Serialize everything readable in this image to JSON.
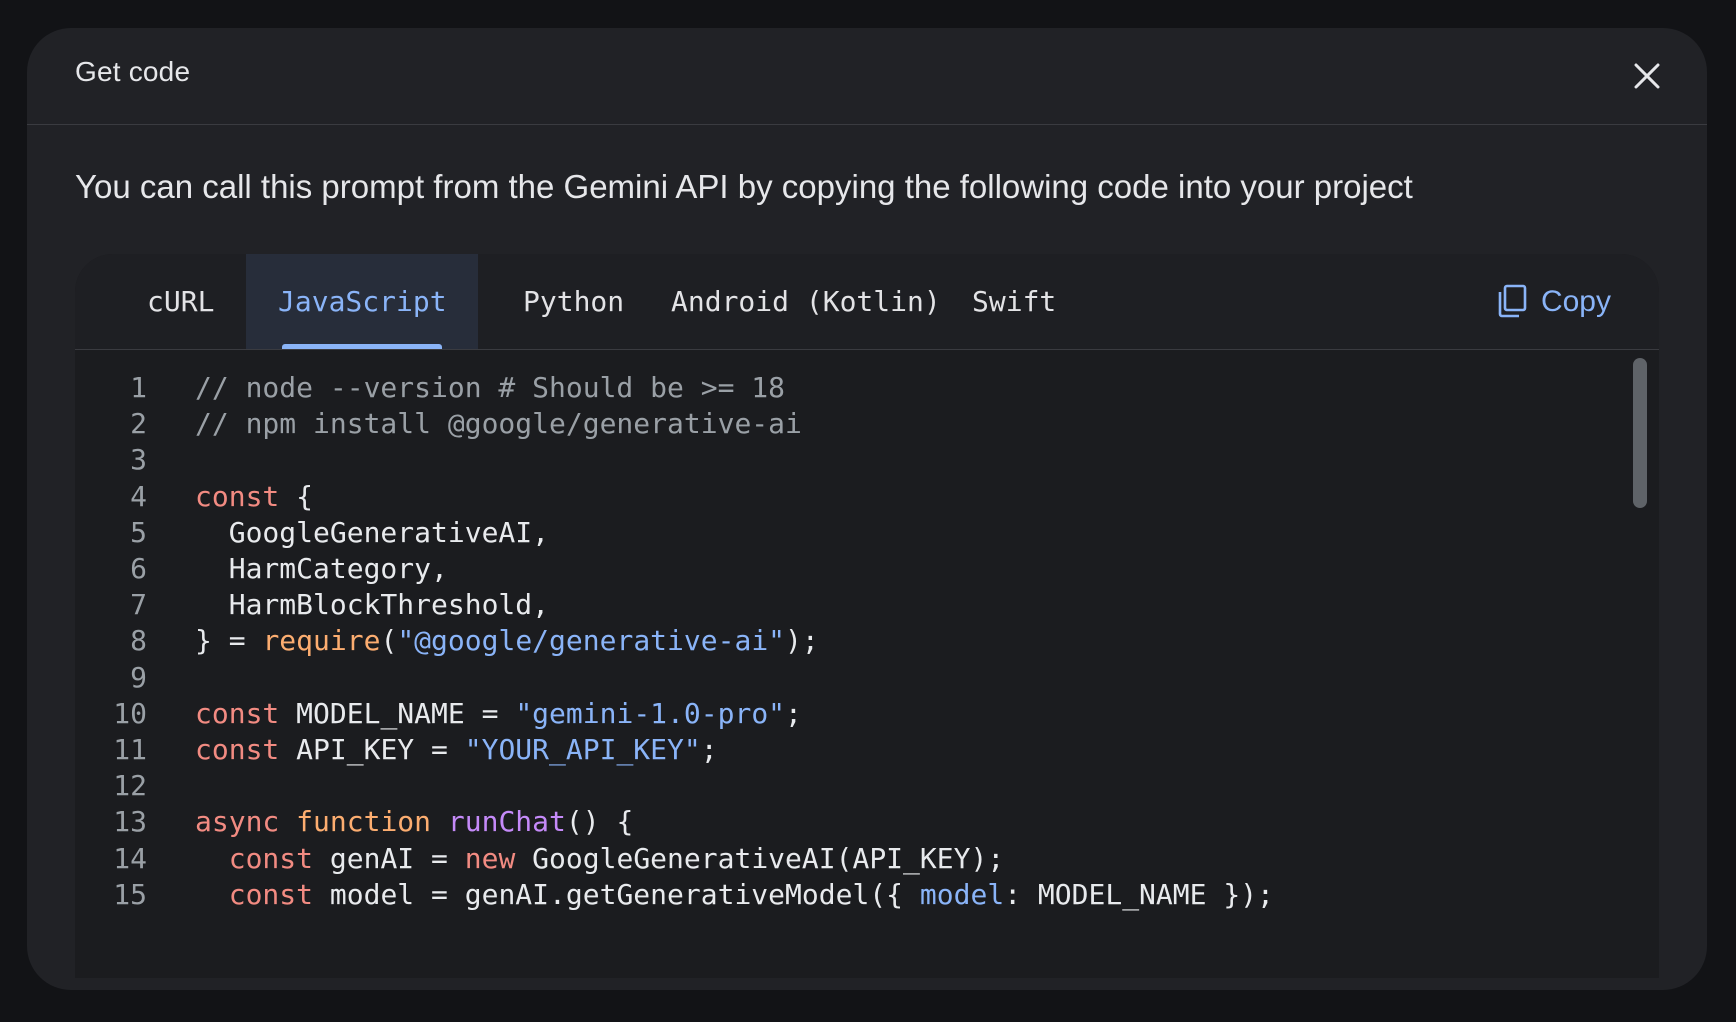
{
  "dialog": {
    "title": "Get code",
    "close_icon": "close-icon",
    "description": "You can call this prompt from the Gemini API by copying the following code into your project"
  },
  "tabs": [
    {
      "label": "cURL",
      "active": false
    },
    {
      "label": "JavaScript",
      "active": true
    },
    {
      "label": "Python",
      "active": false
    },
    {
      "label": "Android (Kotlin)",
      "active": false
    },
    {
      "label": "Swift",
      "active": false
    }
  ],
  "copy": {
    "label": "Copy",
    "icon": "copy-icon"
  },
  "colors": {
    "accent": "#8ab4f8",
    "keyword": "#f28b82",
    "function_call": "#fcad70",
    "string": "#8ab4f8",
    "comment": "#9aa0a6",
    "background": "#212226"
  },
  "code": {
    "language": "JavaScript",
    "lines": [
      {
        "num": "1",
        "segments": [
          {
            "t": "c",
            "text": "// node --version # Should be >= 18"
          }
        ]
      },
      {
        "num": "2",
        "segments": [
          {
            "t": "c",
            "text": "// npm install @google/generative-ai"
          }
        ]
      },
      {
        "num": "3",
        "segments": []
      },
      {
        "num": "4",
        "segments": [
          {
            "t": "k",
            "text": "const"
          },
          {
            "t": "p",
            "text": " {"
          }
        ]
      },
      {
        "num": "5",
        "segments": [
          {
            "t": "p",
            "text": "  GoogleGenerativeAI,"
          }
        ]
      },
      {
        "num": "6",
        "segments": [
          {
            "t": "p",
            "text": "  HarmCategory,"
          }
        ]
      },
      {
        "num": "7",
        "segments": [
          {
            "t": "p",
            "text": "  HarmBlockThreshold,"
          }
        ]
      },
      {
        "num": "8",
        "segments": [
          {
            "t": "p",
            "text": "} = "
          },
          {
            "t": "f",
            "text": "require"
          },
          {
            "t": "p",
            "text": "("
          },
          {
            "t": "s",
            "text": "\"@google/generative-ai\""
          },
          {
            "t": "p",
            "text": ");"
          }
        ]
      },
      {
        "num": "9",
        "segments": []
      },
      {
        "num": "10",
        "segments": [
          {
            "t": "k",
            "text": "const"
          },
          {
            "t": "p",
            "text": " MODEL_NAME = "
          },
          {
            "t": "s",
            "text": "\"gemini-1.0-pro\""
          },
          {
            "t": "p",
            "text": ";"
          }
        ]
      },
      {
        "num": "11",
        "segments": [
          {
            "t": "k",
            "text": "const"
          },
          {
            "t": "p",
            "text": " API_KEY = "
          },
          {
            "t": "s",
            "text": "\"YOUR_API_KEY\""
          },
          {
            "t": "p",
            "text": ";"
          }
        ]
      },
      {
        "num": "12",
        "segments": []
      },
      {
        "num": "13",
        "segments": [
          {
            "t": "k",
            "text": "async"
          },
          {
            "t": "p",
            "text": " "
          },
          {
            "t": "f",
            "text": "function"
          },
          {
            "t": "p",
            "text": " "
          },
          {
            "t": "m",
            "text": "runChat"
          },
          {
            "t": "p",
            "text": "() {"
          }
        ]
      },
      {
        "num": "14",
        "segments": [
          {
            "t": "p",
            "text": "  "
          },
          {
            "t": "k",
            "text": "const"
          },
          {
            "t": "p",
            "text": " genAI = "
          },
          {
            "t": "k",
            "text": "new"
          },
          {
            "t": "p",
            "text": " GoogleGenerativeAI(API_KEY);"
          }
        ]
      },
      {
        "num": "15",
        "segments": [
          {
            "t": "p",
            "text": "  "
          },
          {
            "t": "k",
            "text": "const"
          },
          {
            "t": "p",
            "text": " model = genAI.getGenerativeModel({ "
          },
          {
            "t": "s",
            "text": "model"
          },
          {
            "t": "p",
            "text": ": MODEL_NAME });"
          }
        ]
      }
    ]
  }
}
